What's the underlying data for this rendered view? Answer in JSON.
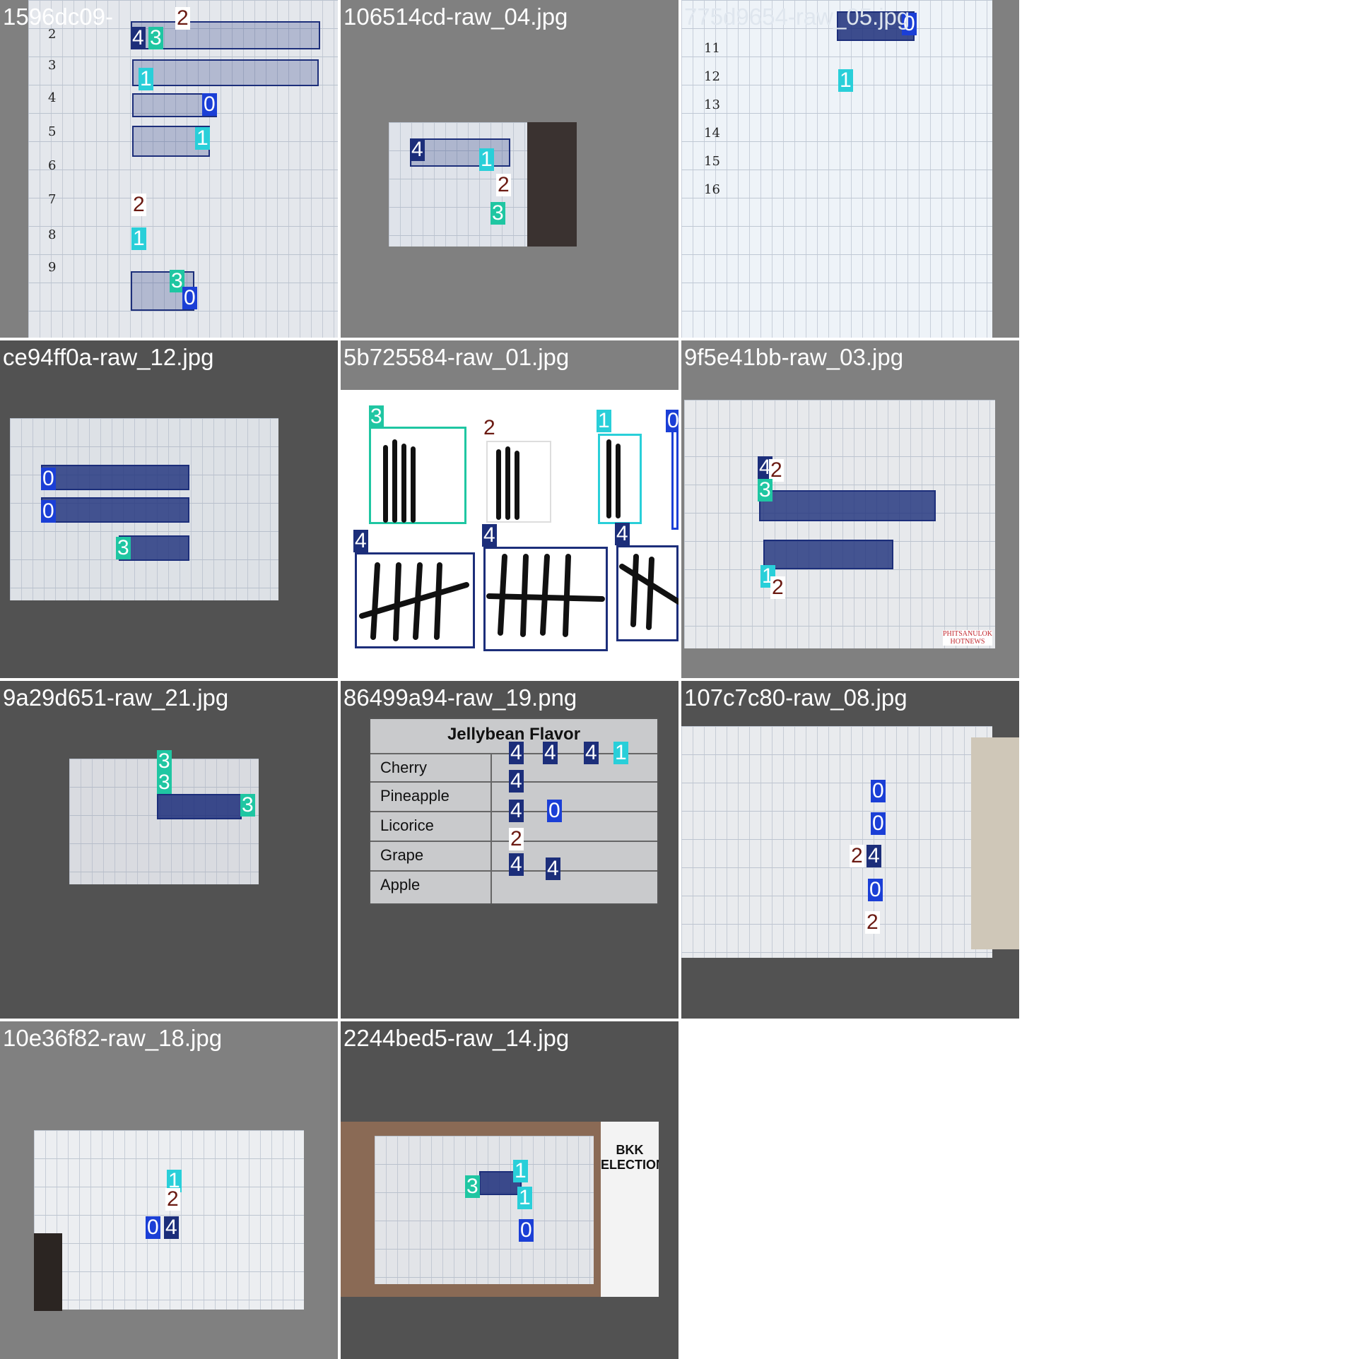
{
  "colors": {
    "class_0": "#1b3fd6",
    "class_1": "#29cfd9",
    "class_2": "#6b1a12",
    "class_3": "#1fc6a2",
    "class_4": "#1c2e7a"
  },
  "class_labels": {
    "c0": "0",
    "c1": "1",
    "c2": "2",
    "c3": "3",
    "c4": "4"
  },
  "tiles": [
    {
      "filename": "1596dc09-"
    },
    {
      "filename": "106514cd-raw_04.jpg"
    },
    {
      "filename": "775d9654-raw_05.jpg"
    },
    {
      "filename": "ce94ff0a-raw_12.jpg"
    },
    {
      "filename": "5b725584-raw_01.jpg"
    },
    {
      "filename": "9f5e41bb-raw_03.jpg"
    },
    {
      "filename": "9a29d651-raw_21.jpg"
    },
    {
      "filename": "86499a94-raw_19.png"
    },
    {
      "filename": "107c7c80-raw_08.jpg"
    },
    {
      "filename": "10e36f82-raw_18.jpg"
    },
    {
      "filename": "2244bed5-raw_14.jpg"
    }
  ],
  "sheet_row_numbers": [
    "2",
    "3",
    "4",
    "5",
    "6",
    "7",
    "8",
    "9"
  ],
  "sheet2_row_numbers": [
    "11",
    "12",
    "13",
    "14",
    "15",
    "16"
  ],
  "jellybean": {
    "title": "Jellybean Flavor",
    "rows": [
      "Cherry",
      "Pineapple",
      "Licorice",
      "Grape",
      "Apple"
    ]
  },
  "watermark": "PHITSANULOK HOTNEWS",
  "bkk_text": "BKK ELECTION"
}
